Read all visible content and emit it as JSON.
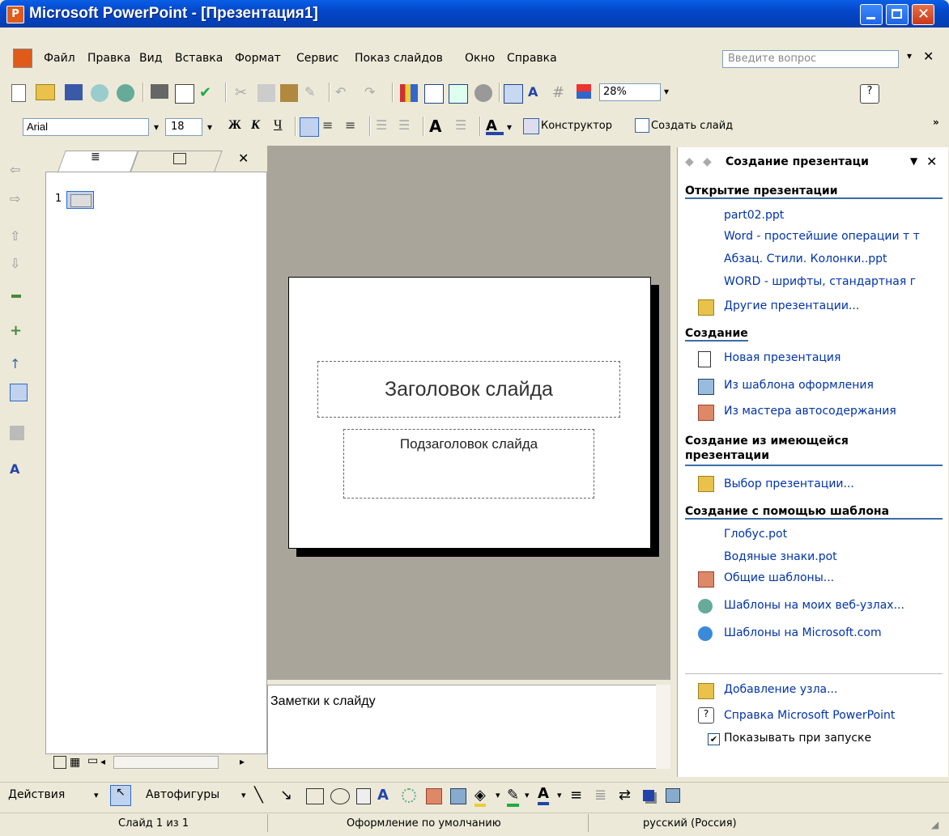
{
  "window": {
    "title": "Microsoft PowerPoint - [Презентация1]",
    "app_icon_letter": "P"
  },
  "menu": {
    "items": [
      "Файл",
      "Правка",
      "Вид",
      "Вставка",
      "Формат",
      "Сервис",
      "Показ слайдов",
      "Окно",
      "Справка"
    ],
    "ask_placeholder": "Введите вопрос"
  },
  "standard_toolbar": {
    "zoom": "28%"
  },
  "format_toolbar": {
    "font": "Arial",
    "size": "18",
    "bold": "Ж",
    "italic": "К",
    "underline": "Ч",
    "designer": "Конструктор",
    "new_slide": "Создать слайд"
  },
  "slides_pane": {
    "slide_number": "1"
  },
  "slide": {
    "title_placeholder": "Заголовок слайда",
    "subtitle_placeholder": "Подзаголовок слайда"
  },
  "notes": {
    "placeholder": "Заметки к слайду"
  },
  "task_pane": {
    "title": "Создание презентаци",
    "open_header": "Открытие презентации",
    "recent_files": [
      "part02.ppt",
      "Word - простейшие операции т т",
      "Абзац. Стили. Колонки..ppt",
      "WORD - шрифты, стандартная г"
    ],
    "other_presentations": "Другие презентации...",
    "create_header": "Создание",
    "new_presentation": "Новая презентация",
    "from_design_template": "Из шаблона оформления",
    "from_autocontent": "Из мастера автосодержания",
    "from_existing_header": "Создание из имеющейся презентации",
    "choose_presentation": "Выбор презентации...",
    "from_template_header": "Создание с помощью шаблона",
    "templates": [
      "Глобус.pot",
      "Водяные знаки.pot"
    ],
    "general_templates": "Общие шаблоны...",
    "web_templates": "Шаблоны на моих веб-узлах...",
    "ms_templates": "Шаблоны на Microsoft.com",
    "add_node": "Добавление узла...",
    "help": "Справка Microsoft PowerPoint",
    "show_at_startup": "Показывать при запуске"
  },
  "draw_toolbar": {
    "actions": "Действия",
    "autoshapes": "Автофигуры"
  },
  "status": {
    "slide": "Слайд 1 из 1",
    "design": "Оформление по умолчанию",
    "language": "русский (Россия)"
  }
}
